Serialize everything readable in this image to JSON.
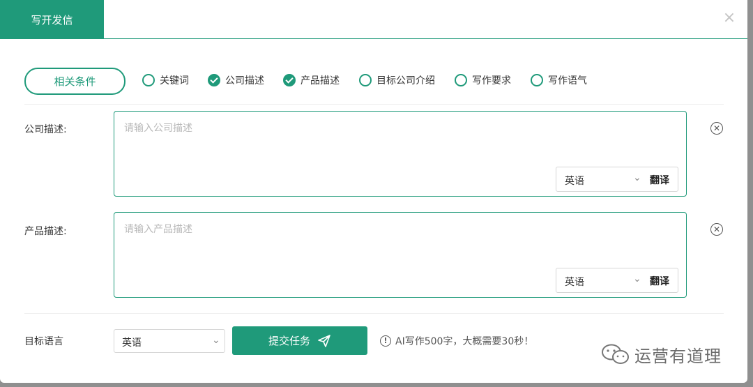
{
  "dialog": {
    "title": "写开发信",
    "close_label": "×"
  },
  "conditions": {
    "button_label": "相关条件",
    "options": [
      {
        "label": "关键词",
        "checked": false
      },
      {
        "label": "公司描述",
        "checked": true
      },
      {
        "label": "产品描述",
        "checked": true
      },
      {
        "label": "目标公司介绍",
        "checked": false
      },
      {
        "label": "写作要求",
        "checked": false
      },
      {
        "label": "写作语气",
        "checked": false
      }
    ]
  },
  "company": {
    "label": "公司描述:",
    "placeholder": "请输入公司描述",
    "language": "英语",
    "translate_label": "翻译"
  },
  "product": {
    "label": "产品描述:",
    "placeholder": "请输入产品描述",
    "language": "英语",
    "translate_label": "翻译"
  },
  "target": {
    "label": "目标语言",
    "language": "英语"
  },
  "submit": {
    "label": "提交任务"
  },
  "notice": {
    "text": "AI写作500字，大概需要30秒！"
  },
  "watermark": {
    "text": "运营有道理"
  },
  "colors": {
    "accent": "#1f9a7a"
  },
  "icons": {
    "close": "close-icon",
    "clear": "clear-circle-icon",
    "chevron": "chevron-down-icon",
    "send": "send-icon",
    "info": "info-icon",
    "wechat": "wechat-icon"
  }
}
